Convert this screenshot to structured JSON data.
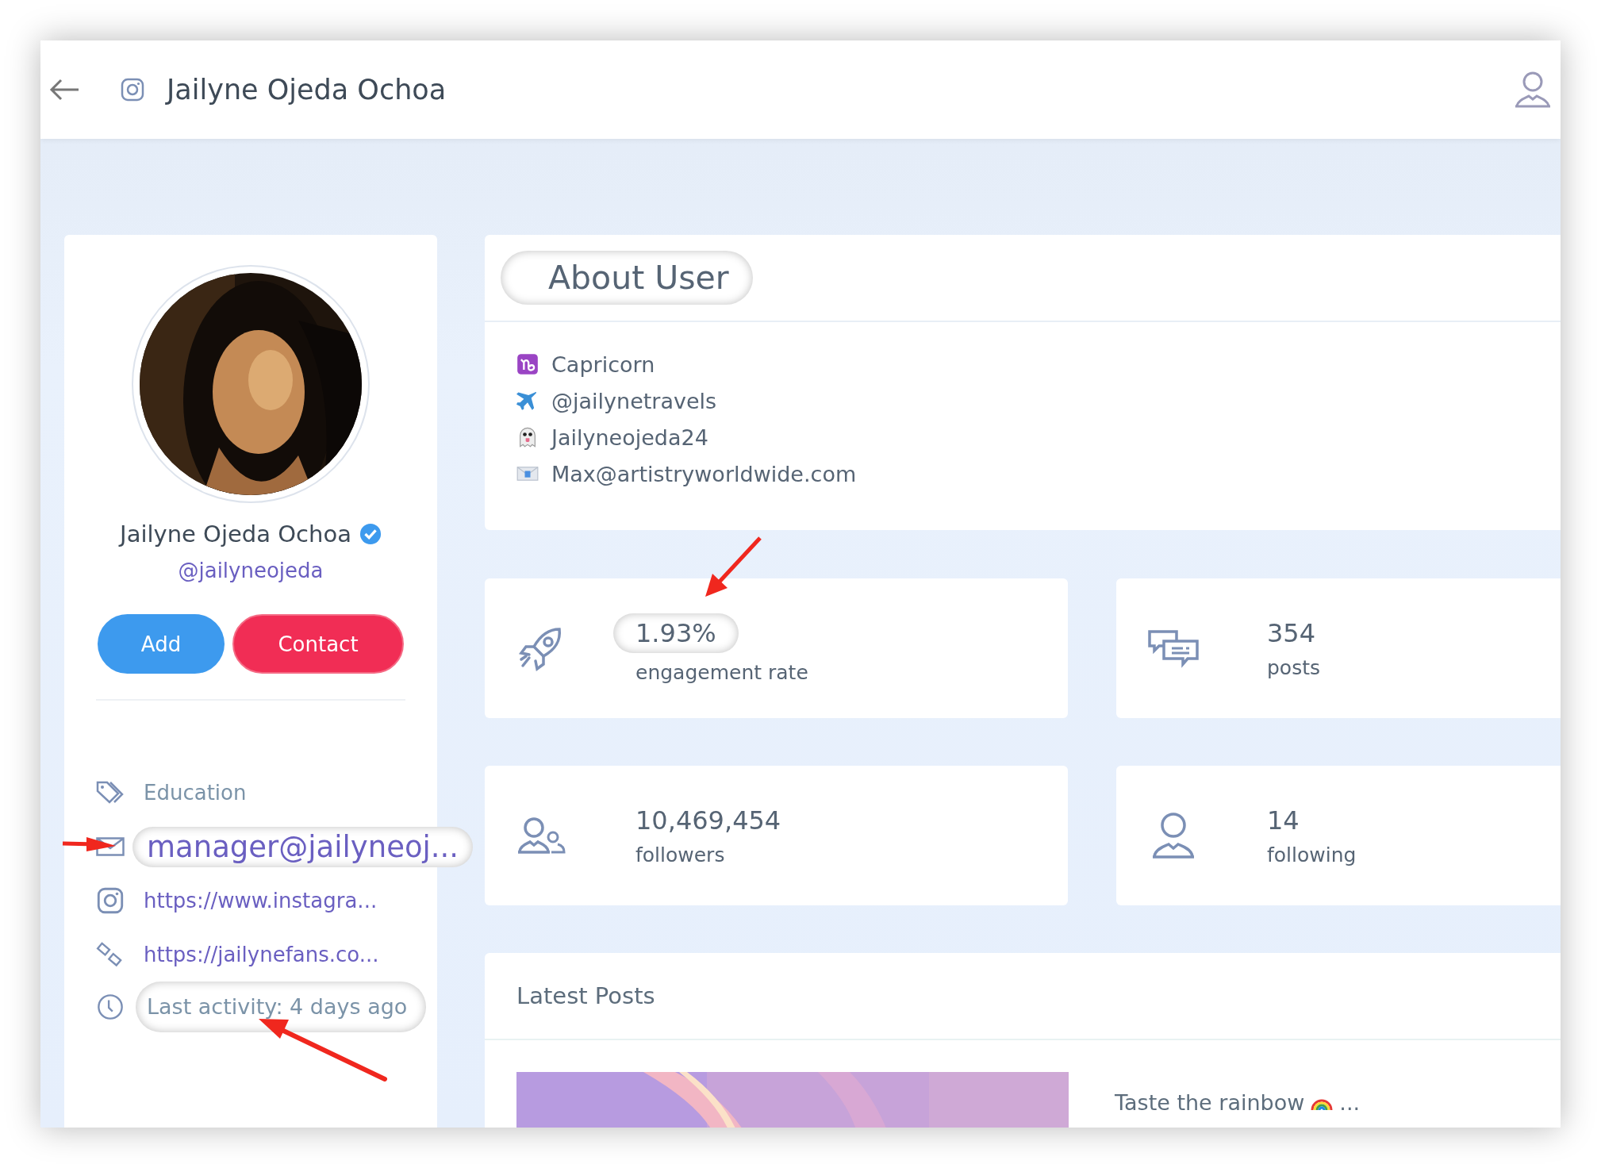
{
  "header": {
    "title": "Jailyne Ojeda Ochoa"
  },
  "profile": {
    "name": "Jailyne Ojeda Ochoa",
    "verified": true,
    "handle": "@jailyneojeda",
    "buttons": [
      {
        "label": "Add",
        "kind": "primary"
      },
      {
        "label": "Contact",
        "kind": "danger"
      }
    ],
    "details": [
      {
        "kind": "tag",
        "text": "Education",
        "link": false,
        "highlighted": false
      },
      {
        "kind": "email",
        "text": "manager@jailyneoj...",
        "link": true,
        "highlighted": true
      },
      {
        "kind": "instagram",
        "text": "https://www.instagra...",
        "link": true,
        "highlighted": false
      },
      {
        "kind": "website",
        "text": "https://jailynefans.co...",
        "link": true,
        "highlighted": false
      },
      {
        "kind": "activity",
        "text": "Last activity: 4 days ago",
        "link": false,
        "highlighted": true
      }
    ]
  },
  "about": {
    "title": "About User",
    "highlighted": true,
    "items": [
      {
        "kind": "zodiac",
        "text": "Capricorn"
      },
      {
        "kind": "travel",
        "text": "@jailynetravels"
      },
      {
        "kind": "ghost",
        "text": "Jailyneojeda24"
      },
      {
        "kind": "mail",
        "text": "Max@artistryworldwide.com"
      }
    ]
  },
  "stats": [
    {
      "kind": "engagement",
      "value": "1.93%",
      "label": "engagement rate",
      "highlighted": true
    },
    {
      "kind": "posts",
      "value": "354",
      "label": "posts",
      "highlighted": false
    },
    {
      "kind": "followers",
      "value": "10,469,454",
      "label": "followers",
      "highlighted": false
    },
    {
      "kind": "following",
      "value": "14",
      "label": "following",
      "highlighted": false
    }
  ],
  "latest_posts": {
    "title": "Latest Posts",
    "items": [
      {
        "kind": "picture",
        "caption": "Taste the rainbow",
        "more": "..."
      }
    ]
  }
}
